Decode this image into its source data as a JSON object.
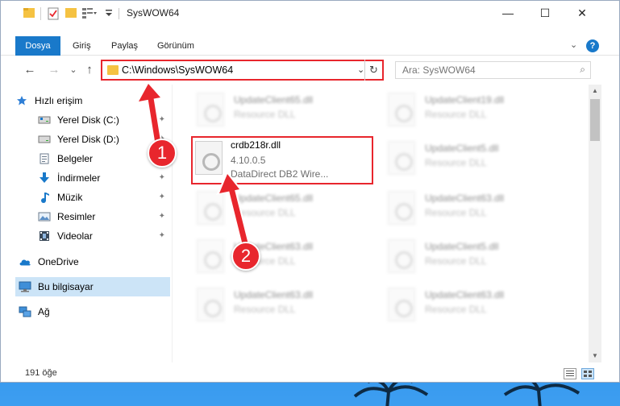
{
  "window": {
    "title": "SysWOW64",
    "minimize_glyph": "—",
    "maximize_glyph": "☐",
    "close_glyph": "✕"
  },
  "ribbon": {
    "tabs": [
      "Dosya",
      "Giriş",
      "Paylaş",
      "Görünüm"
    ],
    "collapse_glyph": "⌄",
    "help_glyph": "?"
  },
  "nav": {
    "back_glyph": "←",
    "forward_glyph": "→",
    "recent_glyph": "⌄",
    "up_glyph": "↑",
    "address": "C:\\Windows\\SysWOW64",
    "address_dropdown_glyph": "⌄",
    "refresh_glyph": "↻",
    "search_placeholder": "Ara: SysWOW64",
    "search_glyph": "⌕"
  },
  "sidebar": {
    "items": [
      {
        "label": "Hızlı erişim",
        "icon": "star-icon",
        "pinned": false
      },
      {
        "label": "Yerel Disk (C:)",
        "icon": "drive-icon",
        "pinned": true
      },
      {
        "label": "Yerel Disk (D:)",
        "icon": "drive-icon",
        "pinned": true
      },
      {
        "label": "Belgeler",
        "icon": "document-icon",
        "pinned": true
      },
      {
        "label": "İndirmeler",
        "icon": "download-icon",
        "pinned": true
      },
      {
        "label": "Müzik",
        "icon": "music-icon",
        "pinned": true
      },
      {
        "label": "Resimler",
        "icon": "pictures-icon",
        "pinned": true
      },
      {
        "label": "Videolar",
        "icon": "video-icon",
        "pinned": true
      },
      {
        "label": "OneDrive",
        "icon": "cloud-icon",
        "pinned": false
      },
      {
        "label": "Bu bilgisayar",
        "icon": "computer-icon",
        "pinned": false
      },
      {
        "label": "Ağ",
        "icon": "network-icon",
        "pinned": false
      }
    ],
    "pin_glyph": "📌"
  },
  "files": {
    "left_column": [
      {
        "name": "UpdateClient65.dll",
        "sub": "Resource DLL",
        "blurred": true
      },
      {
        "name": "crdb218r.dll",
        "sub": "4.10.0.5",
        "sub2": "DataDirect DB2 Wire...",
        "blurred": false
      },
      {
        "name": "UpdateClient65.dll",
        "sub": "Resource DLL",
        "blurred": true
      },
      {
        "name": "UpdateClient63.dll",
        "sub": "Resource DLL",
        "blurred": true
      },
      {
        "name": "UpdateClient63.dll",
        "sub": "Resource DLL",
        "blurred": true
      }
    ],
    "right_column": [
      {
        "name": "UpdateClient19.dll",
        "sub": "Resource DLL"
      },
      {
        "name": "UpdateClient5.dll",
        "sub": "Resource DLL"
      },
      {
        "name": "UpdateClient63.dll",
        "sub": "Resource DLL"
      },
      {
        "name": "UpdateClient5.dll",
        "sub": "Resource DLL"
      },
      {
        "name": "UpdateClient63.dll",
        "sub": "Resource DLL"
      }
    ]
  },
  "status": {
    "count": "191 öğe"
  },
  "annotations": {
    "badge_1": "1",
    "badge_2": "2"
  },
  "colors": {
    "accent": "#1979ca",
    "annotation_red": "#e8262d",
    "selected": "#cce4f7"
  }
}
